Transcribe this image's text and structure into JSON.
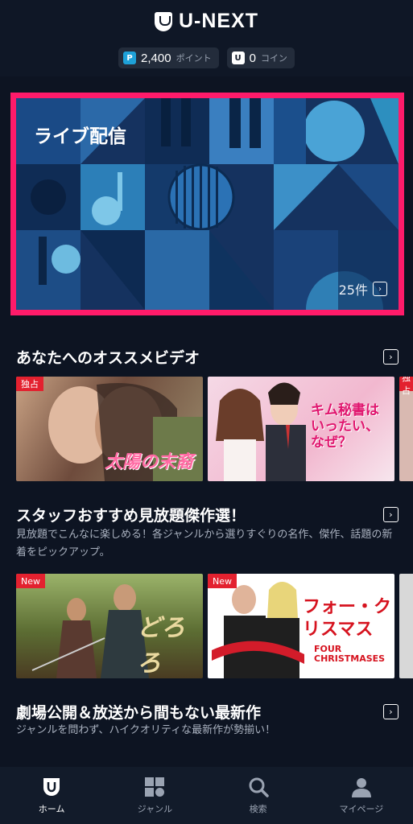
{
  "header": {
    "logo_text": "U-NEXT",
    "points": {
      "value": "2,400",
      "unit": "ポイント",
      "icon": "P"
    },
    "coins": {
      "value": "0",
      "unit": "コイン",
      "icon": "U"
    }
  },
  "banner": {
    "title": "ライブ配信",
    "count": "25件"
  },
  "sections": [
    {
      "title": "あなたへのオススメビデオ",
      "description": "",
      "items": [
        {
          "badge": "独占",
          "title": "太陽の末裔"
        },
        {
          "badge": "",
          "title": "キム秘書はいったい、なぜ？"
        },
        {
          "badge": "独占",
          "title": ""
        }
      ]
    },
    {
      "title": "スタッフおすすめ見放題傑作選！",
      "description": "見放題でこんなに楽しめる！各ジャンルから選りすぐりの名作、傑作、話題の新着をピックアップ。",
      "items": [
        {
          "badge": "New",
          "title": "どろろ"
        },
        {
          "badge": "New",
          "title": "フォー・クリスマス",
          "subtitle": "FOUR CHRISTMASES"
        },
        {
          "badge": "",
          "title": ""
        }
      ]
    },
    {
      "title": "劇場公開＆放送から間もない最新作",
      "description": "ジャンルを問わず、ハイクオリティな最新作が勢揃い！"
    }
  ],
  "nav": [
    {
      "label": "ホーム",
      "icon": "home-icon",
      "active": true
    },
    {
      "label": "ジャンル",
      "icon": "genre-icon",
      "active": false
    },
    {
      "label": "検索",
      "icon": "search-icon",
      "active": false
    },
    {
      "label": "マイページ",
      "icon": "mypage-icon",
      "active": false
    }
  ],
  "colors": {
    "accent": "#ff1b6a",
    "background": "#0d1422",
    "badge_red": "#e3212f"
  }
}
